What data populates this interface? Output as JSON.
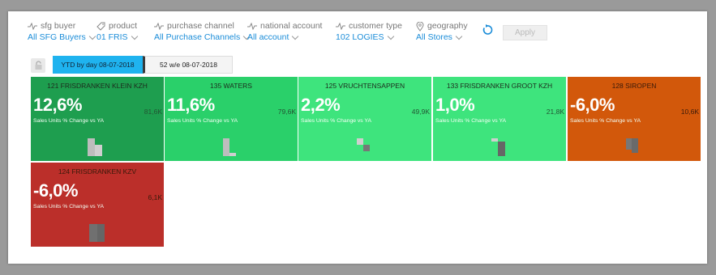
{
  "filters": [
    {
      "label": "sfg buyer",
      "value": "All SFG Buyers",
      "icon": "trend-icon"
    },
    {
      "label": "product",
      "value": "01 FRIS",
      "icon": "tag-icon"
    },
    {
      "label": "purchase channel",
      "value": "All Purchase Channels",
      "icon": "trend-icon"
    },
    {
      "label": "national account",
      "value": "All account",
      "icon": "trend-icon"
    },
    {
      "label": "customer type",
      "value": "102 LOGIES",
      "icon": "trend-icon"
    },
    {
      "label": "geography",
      "value": "All Stores",
      "icon": "pin-icon"
    }
  ],
  "apply_label": "Apply",
  "tabs": {
    "ytd": "YTD by day 08-07-2018",
    "w52": "52 w/e 08-07-2018"
  },
  "metric_label": "Sales Units % Change vs YA",
  "tiles": [
    {
      "title": "121 FRISDRANKEN KLEIN KZH",
      "pct": "12,6%",
      "value": "81,6K",
      "color": "#1e9e4f",
      "change": 12.6
    },
    {
      "title": "135 WATERS",
      "pct": "11,6%",
      "value": "79,6K",
      "color": "#2ad06a",
      "change": 11.6
    },
    {
      "title": "125 VRUCHTENSAPPEN",
      "pct": "2,2%",
      "value": "49,9K",
      "color": "#3ee47d",
      "change": 2.2
    },
    {
      "title": "133 FRISDRANKEN GROOT KZH",
      "pct": "1,0%",
      "value": "21,8K",
      "color": "#3ee47d",
      "change": 1.0
    },
    {
      "title": "128 SIROPEN",
      "pct": "-6,0%",
      "value": "10,6K",
      "color": "#d2580b",
      "change": -6.0
    },
    {
      "title": "124 FRISDRANKEN KZV",
      "pct": "-6,0%",
      "value": "6,1K",
      "color": "#bb2f2a",
      "change": -6.0
    }
  ]
}
